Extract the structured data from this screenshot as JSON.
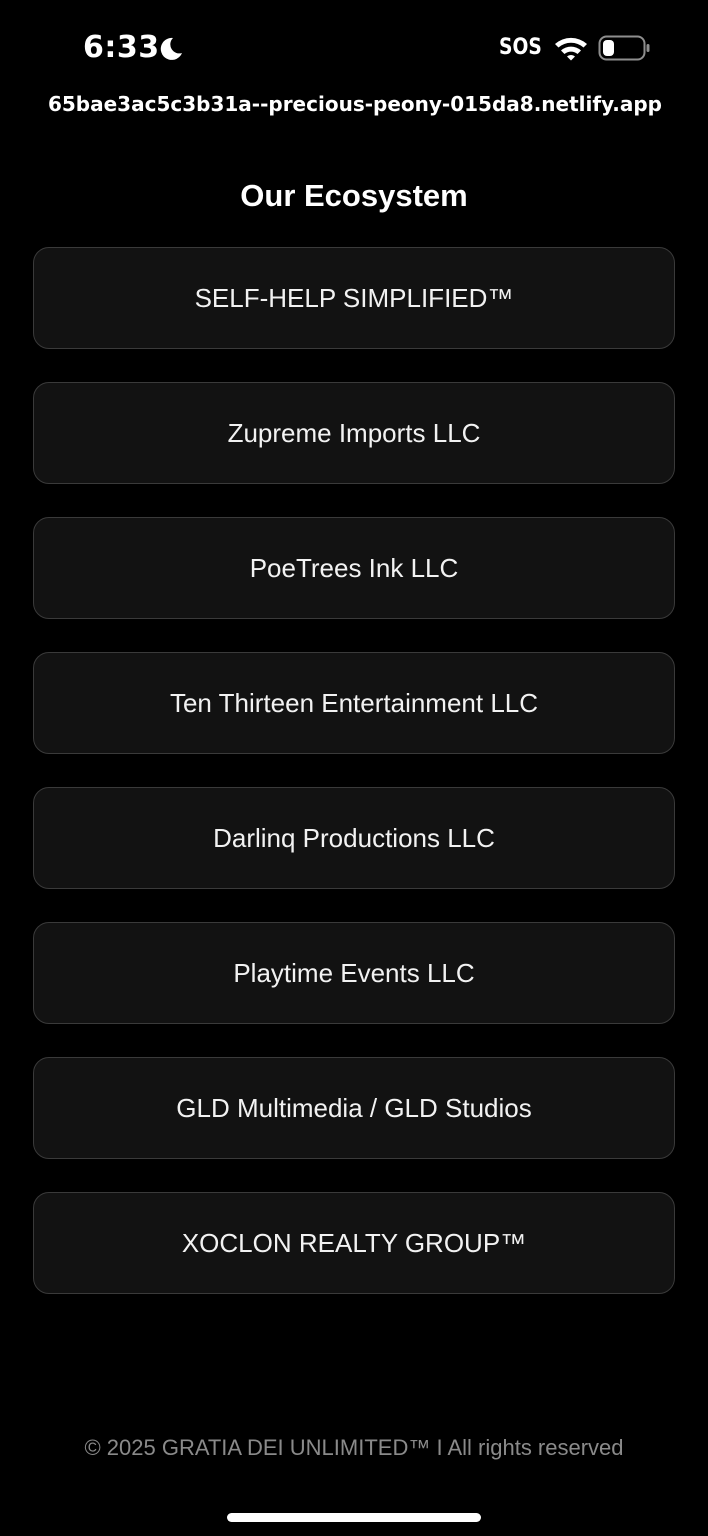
{
  "status_bar": {
    "time": "6:33",
    "sos": "SOS",
    "icons": [
      "moon-icon",
      "wifi-icon",
      "battery-icon"
    ]
  },
  "browser": {
    "url": "65bae3ac5c3b31a--precious-peony-015da8.netlify.app"
  },
  "main": {
    "title": "Our Ecosystem",
    "items": [
      {
        "label": "SELF-HELP SIMPLIFIED™"
      },
      {
        "label": "Zupreme Imports LLC"
      },
      {
        "label": "PoeTrees Ink LLC"
      },
      {
        "label": "Ten Thirteen Entertainment LLC"
      },
      {
        "label": "Darlinq Productions LLC"
      },
      {
        "label": "Playtime Events LLC"
      },
      {
        "label": "GLD Multimedia / GLD Studios"
      },
      {
        "label": "XOCLON REALTY GROUP™"
      }
    ]
  },
  "footer": {
    "text": "© 2025 GRATIA DEI UNLIMITED™ I All rights reserved"
  },
  "colors": {
    "background": "#000000",
    "card_background": "#121212",
    "card_border": "#3a3a3a",
    "text": "#ffffff",
    "footer_text": "#8a8a8a"
  }
}
